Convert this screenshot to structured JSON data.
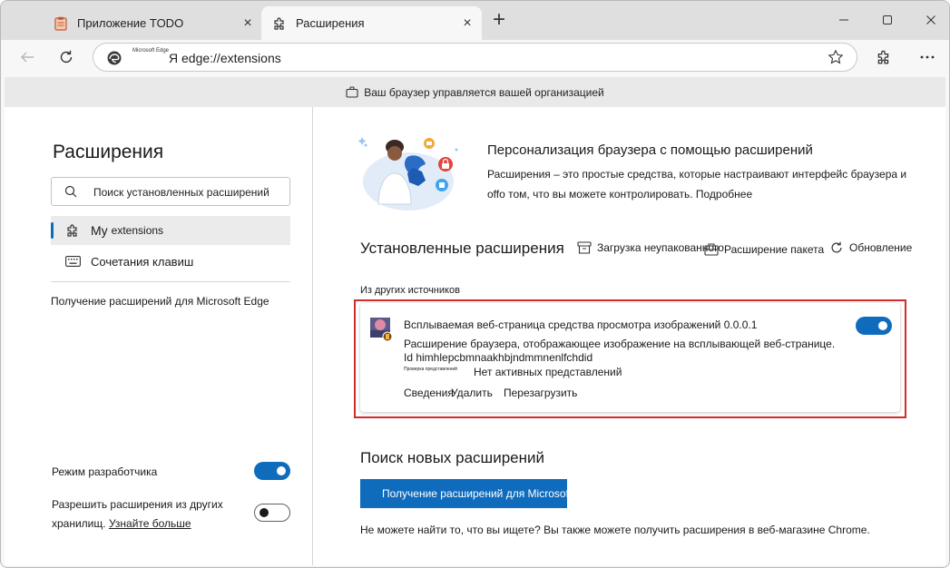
{
  "tabs": [
    {
      "label": "Приложение TODO",
      "icon": "todo-app-icon",
      "active": false
    },
    {
      "label": "Расширения",
      "icon": "extensions-puzzle-icon",
      "active": true
    }
  ],
  "omnibox": {
    "small_label": "Microsoft Edge",
    "url": "Я edge://extensions"
  },
  "banner": {
    "text": "Ваш браузер управляется вашей организацией"
  },
  "sidebar": {
    "title": "Расширения",
    "search_placeholder": "Поиск установленных расширений",
    "items": [
      {
        "label_main": "My",
        "label_sub": "extensions",
        "icon": "extensions-puzzle-icon",
        "selected": true
      },
      {
        "label_main": "Сочетания клавиш",
        "label_sub": "",
        "icon": "keyboard-icon",
        "selected": false
      }
    ],
    "get_extensions_link": "Получение расширений для Microsoft Edge",
    "developer_mode": {
      "label": "Режим разработчика",
      "on": true
    },
    "allow_other_stores": {
      "label": "Разрешить расширения из других хранилищ.",
      "learn_more": "Узнайте больше",
      "on": false
    }
  },
  "promo": {
    "title": "Персонализация браузера с помощью расширений",
    "text": "Расширения – это простые средства, которые настраивают интерфейс браузера и offо том, что вы можете контролировать. Подробнее"
  },
  "installed": {
    "title": "Установленные расширения",
    "actions": [
      {
        "label": "Загрузка неупакованного",
        "icon": "load-unpacked-icon"
      },
      {
        "label": "Расширение пакета",
        "icon": "pack-extension-icon"
      },
      {
        "label": "Обновление",
        "icon": "refresh-icon"
      }
    ],
    "source_label": "Из других источников"
  },
  "extension": {
    "name": "Всплываемая веб-страница средства просмотра изображений 0.0.0.1",
    "description": "Расширение браузера, отображающее изображение на всплывающей веб-странице.",
    "id_text": "Id himhlepcbmnaakhbjndmmnenlfchdid",
    "inspect_label": "Проверка представлений",
    "views_text": "Нет активных представлений",
    "links": {
      "details": "Сведения",
      "remove": "Удалить",
      "reload": "Перезагрузить"
    },
    "enabled": true
  },
  "find": {
    "title": "Поиск новых расширений",
    "button": "Получение расширений для Microsoft Edge",
    "text": "Не можете найти то, что вы ищете? Вы также можете получить расширения в веб-магазине Chrome."
  },
  "colors": {
    "accent": "#0f6cbd",
    "highlight": "#d12c2c"
  }
}
